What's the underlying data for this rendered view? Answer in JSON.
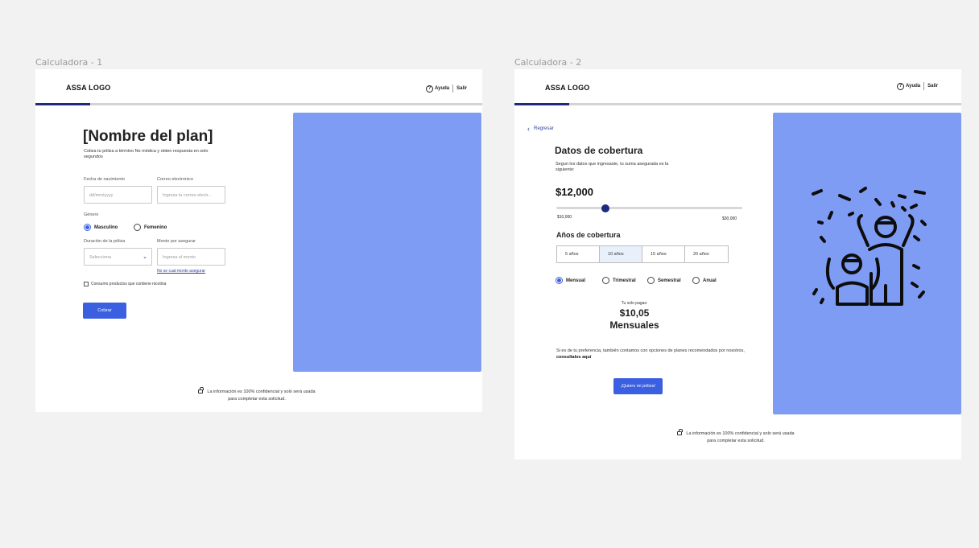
{
  "frame1": {
    "label": "Calculadora - 1",
    "logo": "ASSA LOGO",
    "help_label": "Ayuda",
    "exit_label": "Salir",
    "progress": 0.12,
    "title": "[Nombre del plan]",
    "subtitle_line1": "Cotiza tu póliza a término No médica y obten respuesta en solo",
    "subtitle_line2": "segundos",
    "birth_label": "Fecha de nacimiento",
    "birth_placeholder": "dd/mm/yyyy",
    "email_label": "Correo electronico",
    "email_placeholder": "Ingresa tu correo electr...",
    "gender_label": "Género",
    "gender_options": [
      "Masculino",
      "Femenino"
    ],
    "gender_selected": "Masculino",
    "duration_label": "Duración de la póliza",
    "duration_placeholder": "Selecciona",
    "amount_label": "Monto por asegurar",
    "amount_placeholder": "Ingresa el monto",
    "amount_help_link": "No se cual monto asegurar",
    "nicotine_label": "Consumo productos que contiene nicotina",
    "quote_button": "Cotizar",
    "footer_line1": "La información es 100% confidencial y solo será usada",
    "footer_line2": "para completar esta solicitud.",
    "panel_color": "#7f9cf5"
  },
  "frame2": {
    "label": "Calculadora - 2",
    "logo": "ASSA LOGO",
    "help_label": "Ayuda",
    "exit_label": "Salir",
    "progress": 0.12,
    "back_label": "Regresar",
    "title": "Datos de cobertura",
    "intro_line1": "Segun los datos que ingresaste, tu suma asegurada es la",
    "intro_line2": "siguiente:",
    "insured_amount": "$12,000",
    "slider_min": "$10,000",
    "slider_max": "$30,000",
    "slider_value": 12000,
    "years_title": "Años de cobertura",
    "years_options": [
      "5 años",
      "10 años",
      "15 años",
      "20 años"
    ],
    "years_selected": "10 años",
    "frequency_options": [
      "Mensual",
      "Trimestral",
      "Semestral",
      "Anual"
    ],
    "frequency_selected": "Mensual",
    "pay_label": "Tu solo pagas:",
    "pay_amount": "$10,05",
    "pay_period": "Mensuales",
    "pref_text": "Si es de tu preferencia, también contamos con opciones de planes recomendados por nosotros,",
    "pref_link": "consultalos aquí",
    "cta_button": "¡Quiero mi póliza!",
    "footer_line1": "La información es 100% confidencial y solo será usada",
    "footer_line2": "para completar esta solicitud.",
    "panel_color": "#7f9cf5",
    "illustration": "celebration-icon"
  }
}
